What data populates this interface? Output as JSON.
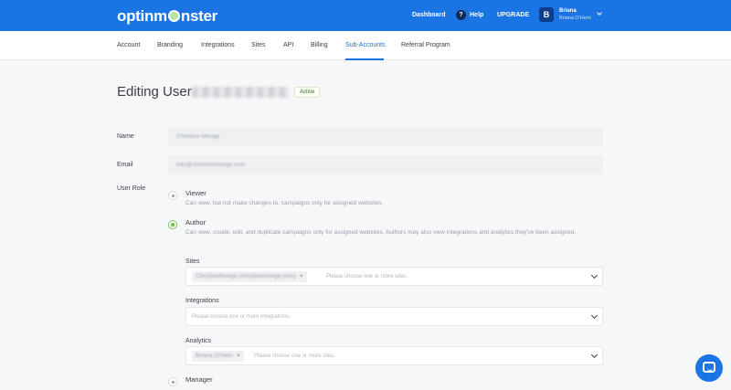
{
  "brand": {
    "logo_text_1": "optinm",
    "logo_text_2": "nster"
  },
  "topnav": {
    "dashboard": "Dashboard",
    "help": "Help",
    "help_icon": "?",
    "upgrade": "UPGRADE",
    "avatar_letter": "B",
    "user_name": "Briana",
    "user_sub": "Briana O'Hern"
  },
  "subnav": {
    "items": [
      "Account",
      "Branding",
      "Integrations",
      "Sites",
      "API",
      "Billing",
      "Sub-Accounts",
      "Referral Program"
    ],
    "active": "Sub-Accounts"
  },
  "page": {
    "title": "Editing User",
    "status_badge": "Active"
  },
  "form": {
    "name_label": "Name",
    "name_value": "Christine Monge",
    "email_label": "Email",
    "email_value": "info@christinemonge.com",
    "role_label": "User Role",
    "roles": [
      {
        "title": "Viewer",
        "desc": "Can view, but not make changes to, campaigns only for assigned websites.",
        "checked": false
      },
      {
        "title": "Author",
        "desc": "Can view, create, edit, and duplicate campaigns only for assigned websites. Authors may also view integrations and analytics they've been assigned.",
        "checked": true
      },
      {
        "title": "Manager",
        "desc": "",
        "checked": false
      }
    ],
    "sites": {
      "label": "Sites",
      "chip": "ChristineMonge (christinemonge.com)",
      "placeholder": "Please choose one or more sites."
    },
    "integrations": {
      "label": "Integrations",
      "placeholder": "Please choose one or more integrations."
    },
    "analytics": {
      "label": "Analytics",
      "chip": "Briana O'Hern",
      "placeholder": "Please choose one or more sites."
    },
    "chip_remove": "×"
  },
  "icons": {
    "chat": "chat-bubble-icon",
    "chevron": "chevron-down-icon",
    "help": "help-icon"
  },
  "colors": {
    "brand_blue": "#1b74e4",
    "active_green": "#6cbf47"
  }
}
